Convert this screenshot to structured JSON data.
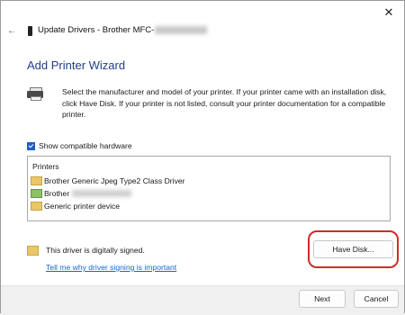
{
  "window": {
    "title_prefix": "Update Drivers - Brother MFC-",
    "close_glyph": "✕",
    "back_glyph": "←"
  },
  "wizard": {
    "heading": "Add Printer Wizard",
    "intro": "Select the manufacturer and model of your printer. If your printer came with an installation disk, click Have Disk. If your printer is not listed, consult your printer documentation for a compatible printer."
  },
  "show_compatible": {
    "label": "Show compatible hardware",
    "checked": true
  },
  "printers_list": {
    "header": "Printers",
    "items": [
      {
        "label": "Brother Generic Jpeg Type2 Class Driver",
        "icon": "folder-icon"
      },
      {
        "label": "Brother",
        "icon": "printer-folder-icon"
      },
      {
        "label": "Generic printer device",
        "icon": "folder-icon"
      }
    ]
  },
  "signature": {
    "status": "This driver is digitally signed.",
    "link": "Tell me why driver signing is important"
  },
  "buttons": {
    "have_disk": "Have Disk...",
    "next": "Next",
    "cancel": "Cancel"
  },
  "colors": {
    "heading": "#1f3f86",
    "link": "#1d64c8",
    "highlight": "#d42a2a",
    "checkbox": "#1f5fbf"
  }
}
